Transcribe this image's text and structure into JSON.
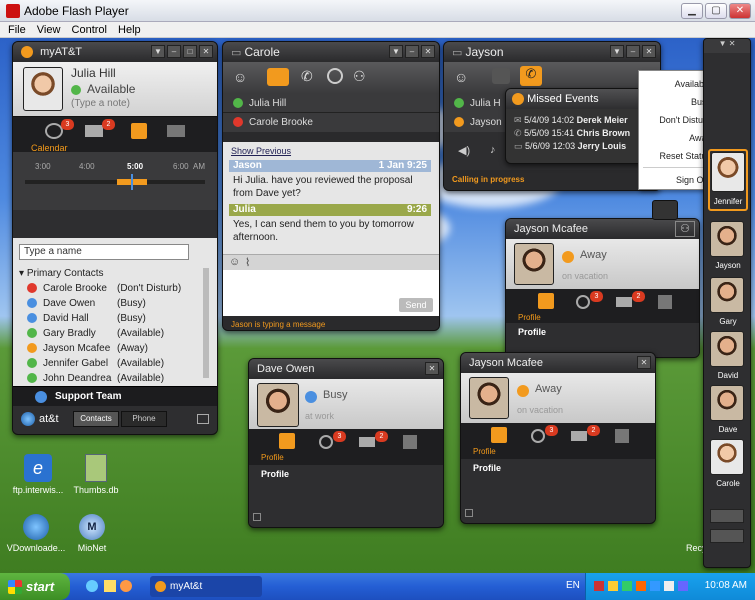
{
  "window": {
    "title": "Adobe Flash Player",
    "menu": [
      "File",
      "View",
      "Control",
      "Help"
    ]
  },
  "myatt": {
    "title": "myAT&T",
    "user_name": "Julia Hill",
    "status": "Available",
    "note_placeholder": "(Type a note)",
    "badges": {
      "missed": "3",
      "mail": "2"
    },
    "calendar_label": "Calendar",
    "timeline": [
      "3:00",
      "4:00",
      "5:00",
      "6:00",
      "AM"
    ],
    "search_placeholder": "Type a name",
    "group_label": "Primary Contacts",
    "contacts": [
      {
        "name": "Carole Brooke",
        "status": "(Don't Disturb)",
        "color": "red"
      },
      {
        "name": "Dave Owen",
        "status": "(Busy)",
        "color": "blue"
      },
      {
        "name": "David Hall",
        "status": "(Busy)",
        "color": "blue"
      },
      {
        "name": "Gary Bradly",
        "status": "(Available)",
        "color": "green"
      },
      {
        "name": "Jayson Mcafee",
        "status": "(Away)",
        "color": "orange"
      },
      {
        "name": "Jennifer Gabel",
        "status": "(Available)",
        "color": "green"
      },
      {
        "name": "John Deandrea",
        "status": "(Available)",
        "color": "green"
      }
    ],
    "support_label": "Support Team",
    "brand": "at&t",
    "tabs": {
      "contacts": "Contacts",
      "phone": "Phone"
    }
  },
  "carole": {
    "title": "Carole",
    "participants": [
      {
        "name": "Julia Hill",
        "color": "green"
      },
      {
        "name": "Carole Brooke",
        "color": "red"
      }
    ],
    "show_previous": "Show Previous",
    "messages": [
      {
        "sender": "Jason",
        "time": "1 Jan 9:25",
        "text": "Hi Julia. have you reviewed the proposal from Dave yet?"
      },
      {
        "sender": "Julia",
        "time": "9:26",
        "text": "Yes, I can send them to you by tomorrow afternoon."
      }
    ],
    "send_label": "Send",
    "typing": "Jason is typing a message"
  },
  "jayson_call": {
    "title": "Jayson",
    "participants": [
      "Julia H",
      "Jayson"
    ],
    "calling": "Calling in progress"
  },
  "missed_events": {
    "title": "Missed Events",
    "rows": [
      {
        "date": "5/4/09",
        "time": "14:02",
        "name": "Derek Meier"
      },
      {
        "date": "5/5/09",
        "time": "15:41",
        "name": "Chris Brown"
      },
      {
        "date": "5/6/09",
        "time": "12:03",
        "name": "Jerry Louis"
      }
    ]
  },
  "status_menu": {
    "items": [
      {
        "label": "Available",
        "color": "#52b649",
        "glyph": "✓"
      },
      {
        "label": "Busy",
        "color": "#4a8fe0",
        "glyph": "–"
      },
      {
        "label": "Don't Disturb",
        "color": "#e0382c",
        "glyph": "–"
      },
      {
        "label": "Away",
        "color": "#f29a1e",
        "glyph": "◷"
      },
      {
        "label": "Reset Status",
        "color": "#888888",
        "glyph": "?"
      },
      {
        "label": "Sign Out",
        "color": "#666666",
        "glyph": "✕"
      }
    ]
  },
  "jayson_profile_top": {
    "title": "Jayson Mcafee",
    "status": "Away",
    "note": "on vacation",
    "profile_tab": "Profile",
    "profile_heading": "Profile"
  },
  "dave_profile": {
    "title": "Dave Owen",
    "status": "Busy",
    "note": "at work",
    "profile_tab": "Profile",
    "profile_heading": "Profile",
    "badges": {
      "missed": "3",
      "mail": "2"
    }
  },
  "jayson_profile_bottom": {
    "title": "Jayson Mcafee",
    "status": "Away",
    "note": "on vacation",
    "profile_tab": "Profile",
    "profile_heading": "Profile",
    "badges": {
      "missed": "3",
      "mail": "2"
    }
  },
  "right_rail": {
    "selected": "Jennifer",
    "people": [
      "Jayson",
      "Gary",
      "David",
      "Dave",
      "Carole"
    ]
  },
  "desktop_icons": [
    "ftp.interwis...",
    "Thumbs.db",
    "VDownloade...",
    "MioNet"
  ],
  "recycle_label": "Recycle Bin",
  "taskbar": {
    "start": "start",
    "task": "myAt&t",
    "lang": "EN",
    "clock": "10:08 AM"
  }
}
